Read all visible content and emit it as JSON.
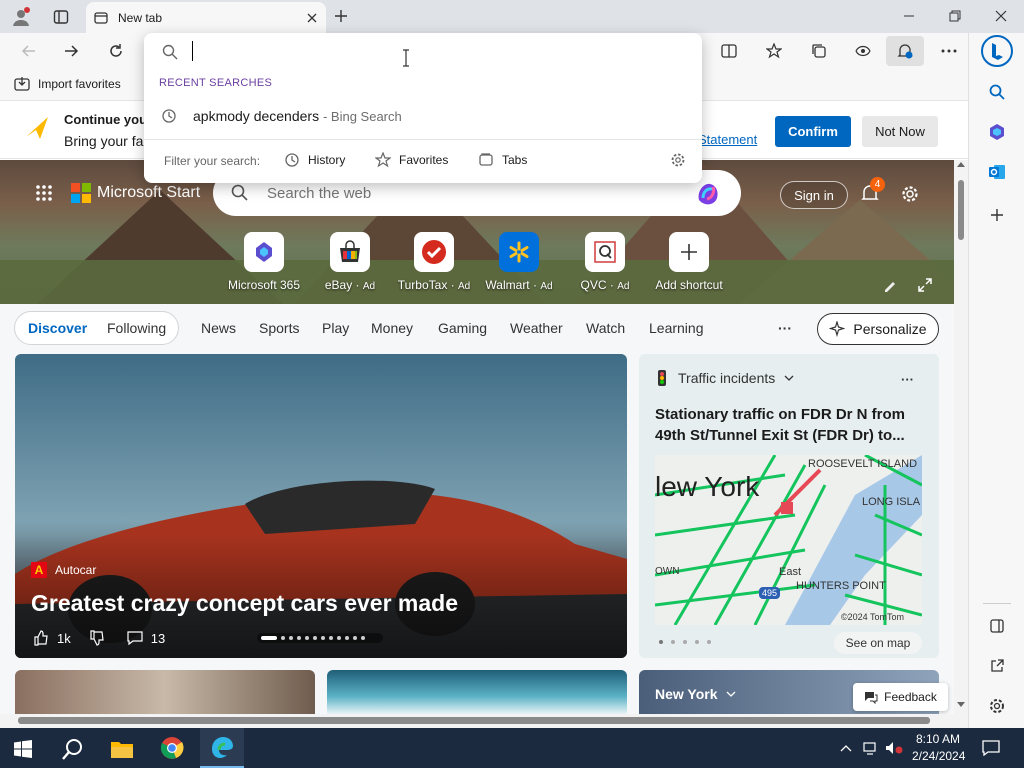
{
  "browser": {
    "tab_title": "New tab",
    "favorites_bar": {
      "import_label": "Import favorites"
    }
  },
  "banner": {
    "title": "Continue your",
    "subtitle": "Bring your fa",
    "link": "Statement",
    "confirm_label": "Confirm",
    "not_now_label": "Not Now"
  },
  "dropdown": {
    "section_label": "RECENT SEARCHES",
    "recent": {
      "query": "apkmody decenders",
      "source": "- Bing Search"
    },
    "filter_label": "Filter your search:",
    "filters": [
      "History",
      "Favorites",
      "Tabs"
    ]
  },
  "start": {
    "brand": "Microsoft Start",
    "search_placeholder": "Search the web",
    "sign_in": "Sign in",
    "notif_count": "4",
    "shortcuts": [
      {
        "label": "Microsoft 365",
        "ad": ""
      },
      {
        "label": "eBay",
        "ad": "Ad"
      },
      {
        "label": "TurboTax",
        "ad": "Ad"
      },
      {
        "label": "Walmart",
        "ad": "Ad"
      },
      {
        "label": "QVC",
        "ad": "Ad"
      },
      {
        "label": "Add shortcut",
        "ad": ""
      }
    ]
  },
  "nav": {
    "discover": "Discover",
    "following": "Following",
    "items": [
      "News",
      "Sports",
      "Play",
      "Money",
      "Gaming",
      "Weather",
      "Watch",
      "Learning"
    ],
    "more": "···",
    "personalize": "Personalize"
  },
  "hero_card": {
    "source": "Autocar",
    "headline": "Greatest crazy concept cars ever made",
    "likes": "1k",
    "comments": "13"
  },
  "traffic_card": {
    "label": "Traffic incidents",
    "headline": "Stationary traffic on FDR Dr N from 49th St/Tunnel Exit St (FDR Dr) to...",
    "map_labels": {
      "city": "lew York",
      "roosevelt": "ROOSEVELT ISLAND",
      "long_island": "LONG ISLA",
      "hunters": "HUNTERS POINT",
      "east": "East",
      "town": "OWN",
      "route": "495",
      "copyright": "©2024 TomTom"
    },
    "see_on_map": "See on map"
  },
  "weather_card": {
    "location": "New York"
  },
  "feedback": "Feedback",
  "taskbar": {
    "time": "8:10 AM",
    "date": "2/24/2024"
  },
  "colors": {
    "accent": "#0067c0",
    "traffic_green": "#14c45c"
  }
}
